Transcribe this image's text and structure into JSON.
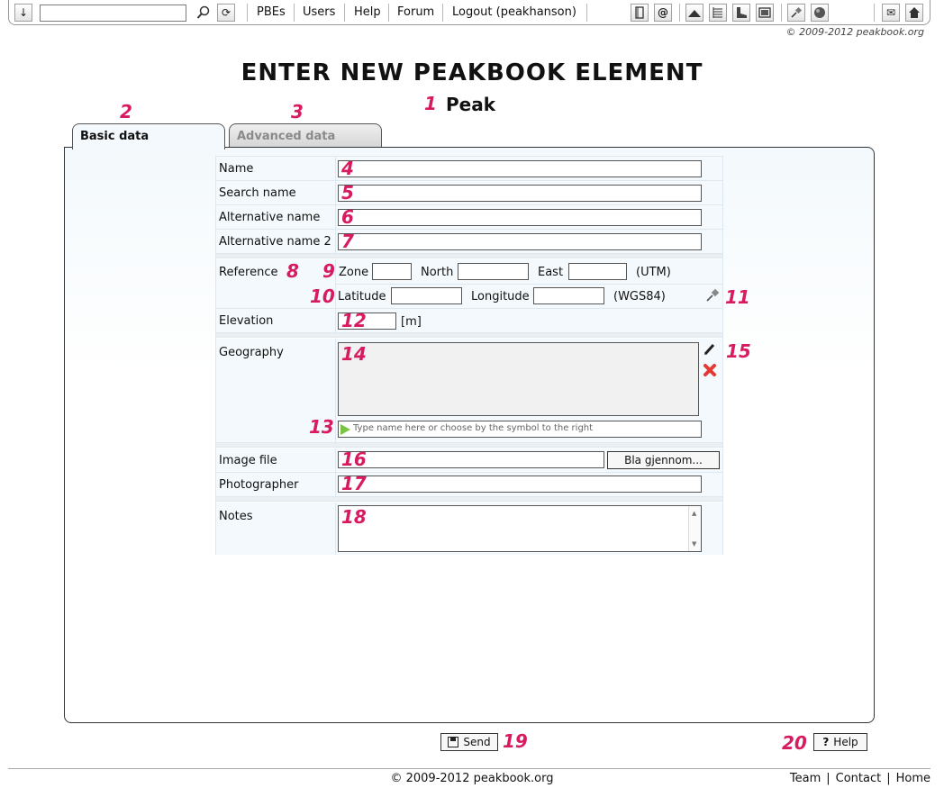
{
  "toolbar": {
    "links": [
      "PBEs",
      "Users",
      "Help",
      "Forum",
      "Logout (peakhanson)"
    ],
    "search_value": "",
    "icons": [
      "down-arrow-icon",
      "magnifier-icon",
      "refresh-icon",
      "book-icon",
      "at-icon",
      "mountain-icon",
      "list-icon",
      "boot-icon",
      "picture-icon",
      "pin-icon",
      "globe-icon",
      "mail-icon",
      "home-icon"
    ]
  },
  "copyright_top": "© 2009-2012 peakbook.org",
  "page_title": "ENTER NEW PEAKBOOK ELEMENT",
  "element_type": "Peak",
  "tabs": {
    "basic": "Basic data",
    "advanced": "Advanced data"
  },
  "form": {
    "name_label": "Name",
    "search_name_label": "Search name",
    "alt_name_label": "Alternative name",
    "alt_name2_label": "Alternative name 2",
    "reference_label": "Reference",
    "zone_label": "Zone",
    "north_label": "North",
    "east_label": "East",
    "utm_label": "(UTM)",
    "latitude_label": "Latitude",
    "longitude_label": "Longitude",
    "wgs_label": "(WGS84)",
    "elevation_label": "Elevation",
    "elevation_unit": "[m]",
    "geography_label": "Geography",
    "geography_placeholder": "Type name here or choose by the symbol to the right",
    "image_file_label": "Image file",
    "browse_button": "Bla gjennom...",
    "photographer_label": "Photographer",
    "notes_label": "Notes"
  },
  "markers": [
    "1",
    "2",
    "3",
    "4",
    "5",
    "6",
    "7",
    "8",
    "9",
    "10",
    "11",
    "12",
    "13",
    "14",
    "15",
    "16",
    "17",
    "18",
    "19",
    "20"
  ],
  "send_button": "Send",
  "help_button": "Help",
  "footer": {
    "copyright": "© 2009-2012 peakbook.org",
    "team": "Team",
    "contact": "Contact",
    "home": "Home"
  },
  "colors": {
    "marker": "#d81b60",
    "panel_bg": "#f3f9fc"
  }
}
